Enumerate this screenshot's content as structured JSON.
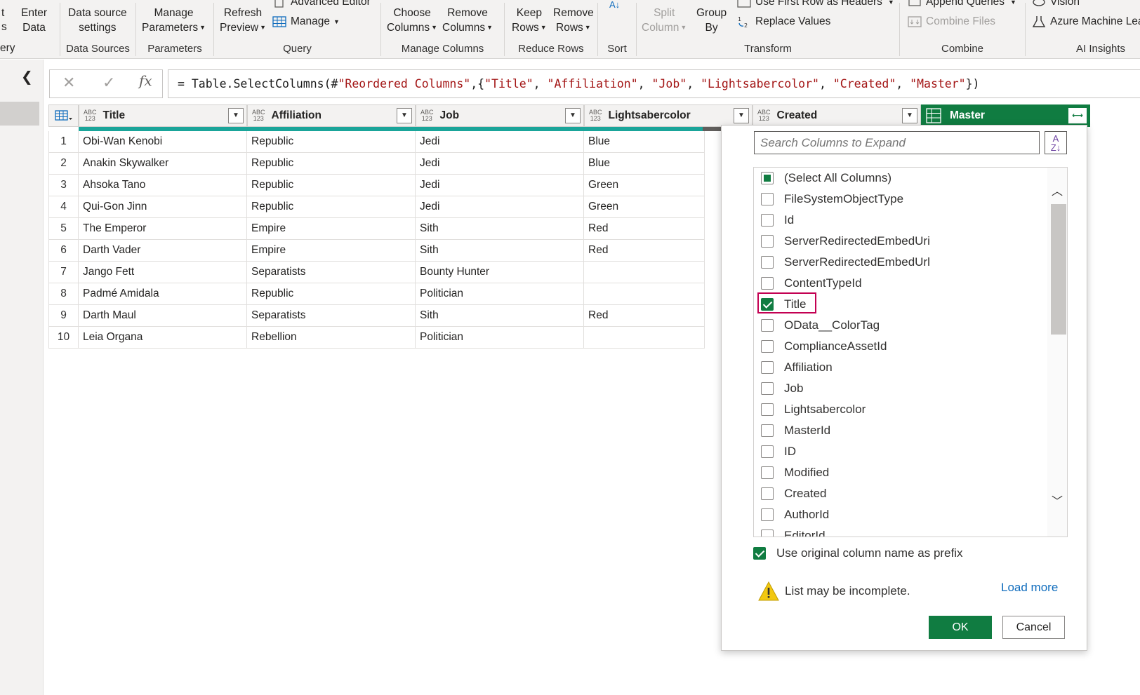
{
  "ribbon": {
    "cut_left_1": "t",
    "cut_left_2": "s",
    "cut_left_group": "ery",
    "enter_data": [
      "Enter",
      "Data"
    ],
    "data_source_settings": [
      "Data source",
      "settings"
    ],
    "manage_parameters": [
      "Manage",
      "Parameters"
    ],
    "refresh_preview": [
      "Refresh",
      "Preview"
    ],
    "advanced_editor": "Advanced Editor",
    "manage": "Manage",
    "choose_columns": [
      "Choose",
      "Columns"
    ],
    "remove_columns": [
      "Remove",
      "Columns"
    ],
    "keep_rows": [
      "Keep",
      "Rows"
    ],
    "remove_rows": [
      "Remove",
      "Rows"
    ],
    "split_column": [
      "Split",
      "Column"
    ],
    "group_by": [
      "Group",
      "By"
    ],
    "use_first_row": "Use First Row as Headers",
    "replace_values": "Replace Values",
    "append_queries": "Append Queries",
    "combine_files": "Combine Files",
    "vision": "Vision",
    "azure_ml": "Azure Machine Lea",
    "groups": {
      "data_sources": "Data Sources",
      "parameters": "Parameters",
      "query": "Query",
      "manage_columns": "Manage Columns",
      "reduce_rows": "Reduce Rows",
      "sort": "Sort",
      "transform": "Transform",
      "combine": "Combine",
      "ai_insights": "AI Insights"
    }
  },
  "formula_bar": {
    "cancel_icon": "✕",
    "commit_icon": "✓",
    "fx_label": "fx",
    "prefix": "= Table.SelectColumns(#",
    "ref": "\"Reordered Columns\"",
    "open": ",{",
    "cols": [
      "\"Title\"",
      "\"Affiliation\"",
      "\"Job\"",
      "\"Lightsabercolor\"",
      "\"Created\"",
      "\"Master\""
    ],
    "sep": ", ",
    "close": "})"
  },
  "grid": {
    "type_label_top": "ABC",
    "type_label_bottom": "123",
    "columns": [
      "Title",
      "Affiliation",
      "Job",
      "Lightsabercolor",
      "Created",
      "Master"
    ],
    "rows": [
      [
        "1",
        "Obi-Wan Kenobi",
        "Republic",
        "Jedi",
        "Blue"
      ],
      [
        "2",
        "Anakin Skywalker",
        "Republic",
        "Jedi",
        "Blue"
      ],
      [
        "3",
        "Ahsoka Tano",
        "Republic",
        "Jedi",
        "Green"
      ],
      [
        "4",
        "Qui-Gon Jinn",
        "Republic",
        "Jedi",
        "Green"
      ],
      [
        "5",
        "The Emperor",
        "Empire",
        "Sith",
        "Red"
      ],
      [
        "6",
        "Darth Vader",
        "Empire",
        "Sith",
        "Red"
      ],
      [
        "7",
        "Jango Fett",
        "Separatists",
        "Bounty Hunter",
        ""
      ],
      [
        "8",
        "Padmé Amidala",
        "Republic",
        "Politician",
        ""
      ],
      [
        "9",
        "Darth Maul",
        "Separatists",
        "Sith",
        "Red"
      ],
      [
        "10",
        "Leia Organa",
        "Rebellion",
        "Politician",
        ""
      ]
    ]
  },
  "expand_panel": {
    "search_placeholder": "Search Columns to Expand",
    "sort_icon_top": "A",
    "sort_icon_bottom": "Z↓",
    "items": [
      {
        "label": "(Select All Columns)",
        "state": "partial"
      },
      {
        "label": "FileSystemObjectType",
        "state": "unchecked"
      },
      {
        "label": "Id",
        "state": "unchecked"
      },
      {
        "label": "ServerRedirectedEmbedUri",
        "state": "unchecked"
      },
      {
        "label": "ServerRedirectedEmbedUrl",
        "state": "unchecked"
      },
      {
        "label": "ContentTypeId",
        "state": "unchecked"
      },
      {
        "label": "Title",
        "state": "checked"
      },
      {
        "label": "OData__ColorTag",
        "state": "unchecked"
      },
      {
        "label": "ComplianceAssetId",
        "state": "unchecked"
      },
      {
        "label": "Affiliation",
        "state": "unchecked"
      },
      {
        "label": "Job",
        "state": "unchecked"
      },
      {
        "label": "Lightsabercolor",
        "state": "unchecked"
      },
      {
        "label": "MasterId",
        "state": "unchecked"
      },
      {
        "label": "ID",
        "state": "unchecked"
      },
      {
        "label": "Modified",
        "state": "unchecked"
      },
      {
        "label": "Created",
        "state": "unchecked"
      },
      {
        "label": "AuthorId",
        "state": "unchecked"
      },
      {
        "label": "EditorId",
        "state": "unchecked"
      }
    ],
    "prefix_label": "Use original column name as prefix",
    "prefix_checked": true,
    "warning_text": "List may be incomplete.",
    "load_more": "Load more",
    "ok": "OK",
    "cancel": "Cancel"
  },
  "colors": {
    "accent_green": "#107c41",
    "quality_bar": "#1aa59a",
    "highlight": "#c30052",
    "link": "#0f6cbd"
  }
}
